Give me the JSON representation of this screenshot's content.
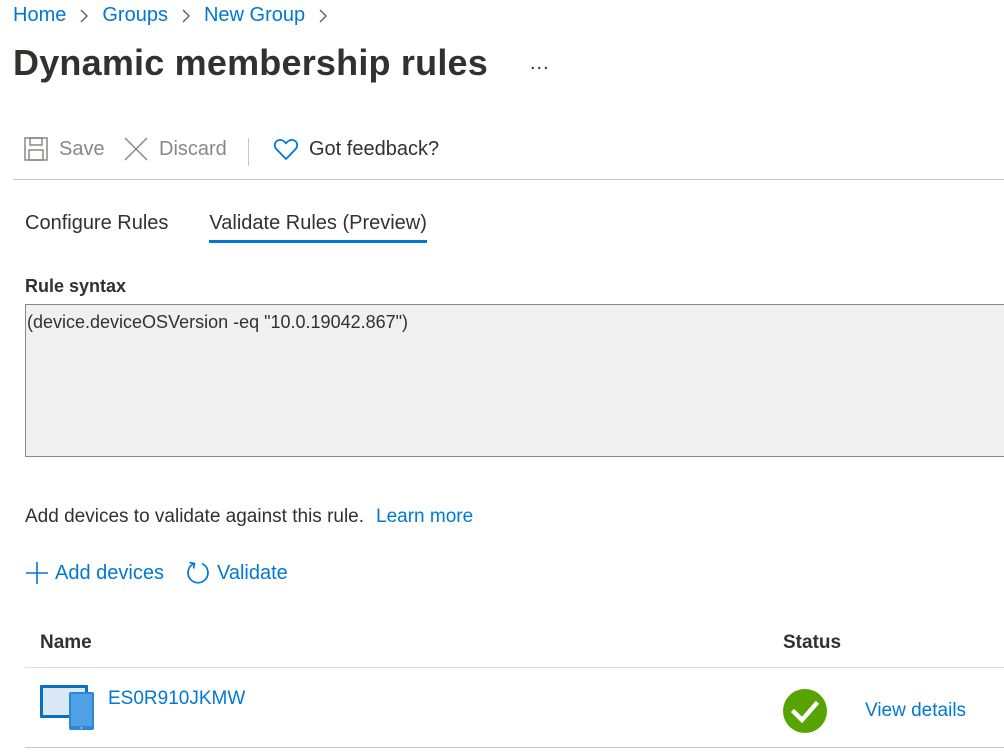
{
  "breadcrumb": {
    "items": [
      "Home",
      "Groups",
      "New Group"
    ]
  },
  "header": {
    "title": "Dynamic membership rules",
    "more": "..."
  },
  "toolbar": {
    "save_label": "Save",
    "discard_label": "Discard",
    "feedback_label": "Got feedback?"
  },
  "tabs": [
    {
      "label": "Configure Rules",
      "active": false
    },
    {
      "label": "Validate Rules (Preview)",
      "active": true
    }
  ],
  "rule": {
    "label": "Rule syntax",
    "syntax": "(device.deviceOSVersion -eq \"10.0.19042.867\")"
  },
  "help": {
    "text": "Add devices to validate against this rule.",
    "link": "Learn more"
  },
  "actions": {
    "add_devices": "Add devices",
    "validate": "Validate"
  },
  "table": {
    "columns": {
      "name": "Name",
      "status": "Status"
    },
    "rows": [
      {
        "name": "ES0R910JKMW",
        "status": "success",
        "details_link": "View details"
      }
    ]
  },
  "colors": {
    "accent": "#0078d4",
    "success": "#57a300",
    "text": "#323130",
    "disabled": "#8a8886"
  }
}
